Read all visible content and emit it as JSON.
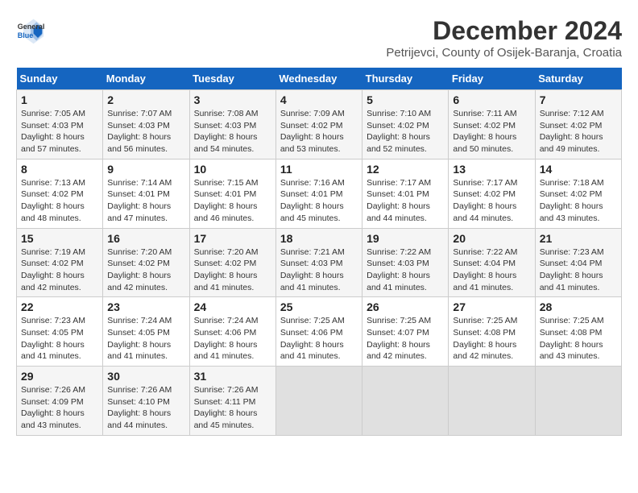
{
  "header": {
    "logo_line1": "General",
    "logo_line2": "Blue",
    "title": "December 2024",
    "subtitle": "Petrijevci, County of Osijek-Baranja, Croatia"
  },
  "days_of_week": [
    "Sunday",
    "Monday",
    "Tuesday",
    "Wednesday",
    "Thursday",
    "Friday",
    "Saturday"
  ],
  "weeks": [
    [
      {
        "day": "1",
        "info": "Sunrise: 7:05 AM\nSunset: 4:03 PM\nDaylight: 8 hours and 57 minutes."
      },
      {
        "day": "2",
        "info": "Sunrise: 7:07 AM\nSunset: 4:03 PM\nDaylight: 8 hours and 56 minutes."
      },
      {
        "day": "3",
        "info": "Sunrise: 7:08 AM\nSunset: 4:03 PM\nDaylight: 8 hours and 54 minutes."
      },
      {
        "day": "4",
        "info": "Sunrise: 7:09 AM\nSunset: 4:02 PM\nDaylight: 8 hours and 53 minutes."
      },
      {
        "day": "5",
        "info": "Sunrise: 7:10 AM\nSunset: 4:02 PM\nDaylight: 8 hours and 52 minutes."
      },
      {
        "day": "6",
        "info": "Sunrise: 7:11 AM\nSunset: 4:02 PM\nDaylight: 8 hours and 50 minutes."
      },
      {
        "day": "7",
        "info": "Sunrise: 7:12 AM\nSunset: 4:02 PM\nDaylight: 8 hours and 49 minutes."
      }
    ],
    [
      {
        "day": "8",
        "info": "Sunrise: 7:13 AM\nSunset: 4:02 PM\nDaylight: 8 hours and 48 minutes."
      },
      {
        "day": "9",
        "info": "Sunrise: 7:14 AM\nSunset: 4:01 PM\nDaylight: 8 hours and 47 minutes."
      },
      {
        "day": "10",
        "info": "Sunrise: 7:15 AM\nSunset: 4:01 PM\nDaylight: 8 hours and 46 minutes."
      },
      {
        "day": "11",
        "info": "Sunrise: 7:16 AM\nSunset: 4:01 PM\nDaylight: 8 hours and 45 minutes."
      },
      {
        "day": "12",
        "info": "Sunrise: 7:17 AM\nSunset: 4:01 PM\nDaylight: 8 hours and 44 minutes."
      },
      {
        "day": "13",
        "info": "Sunrise: 7:17 AM\nSunset: 4:02 PM\nDaylight: 8 hours and 44 minutes."
      },
      {
        "day": "14",
        "info": "Sunrise: 7:18 AM\nSunset: 4:02 PM\nDaylight: 8 hours and 43 minutes."
      }
    ],
    [
      {
        "day": "15",
        "info": "Sunrise: 7:19 AM\nSunset: 4:02 PM\nDaylight: 8 hours and 42 minutes."
      },
      {
        "day": "16",
        "info": "Sunrise: 7:20 AM\nSunset: 4:02 PM\nDaylight: 8 hours and 42 minutes."
      },
      {
        "day": "17",
        "info": "Sunrise: 7:20 AM\nSunset: 4:02 PM\nDaylight: 8 hours and 41 minutes."
      },
      {
        "day": "18",
        "info": "Sunrise: 7:21 AM\nSunset: 4:03 PM\nDaylight: 8 hours and 41 minutes."
      },
      {
        "day": "19",
        "info": "Sunrise: 7:22 AM\nSunset: 4:03 PM\nDaylight: 8 hours and 41 minutes."
      },
      {
        "day": "20",
        "info": "Sunrise: 7:22 AM\nSunset: 4:04 PM\nDaylight: 8 hours and 41 minutes."
      },
      {
        "day": "21",
        "info": "Sunrise: 7:23 AM\nSunset: 4:04 PM\nDaylight: 8 hours and 41 minutes."
      }
    ],
    [
      {
        "day": "22",
        "info": "Sunrise: 7:23 AM\nSunset: 4:05 PM\nDaylight: 8 hours and 41 minutes."
      },
      {
        "day": "23",
        "info": "Sunrise: 7:24 AM\nSunset: 4:05 PM\nDaylight: 8 hours and 41 minutes."
      },
      {
        "day": "24",
        "info": "Sunrise: 7:24 AM\nSunset: 4:06 PM\nDaylight: 8 hours and 41 minutes."
      },
      {
        "day": "25",
        "info": "Sunrise: 7:25 AM\nSunset: 4:06 PM\nDaylight: 8 hours and 41 minutes."
      },
      {
        "day": "26",
        "info": "Sunrise: 7:25 AM\nSunset: 4:07 PM\nDaylight: 8 hours and 42 minutes."
      },
      {
        "day": "27",
        "info": "Sunrise: 7:25 AM\nSunset: 4:08 PM\nDaylight: 8 hours and 42 minutes."
      },
      {
        "day": "28",
        "info": "Sunrise: 7:25 AM\nSunset: 4:08 PM\nDaylight: 8 hours and 43 minutes."
      }
    ],
    [
      {
        "day": "29",
        "info": "Sunrise: 7:26 AM\nSunset: 4:09 PM\nDaylight: 8 hours and 43 minutes."
      },
      {
        "day": "30",
        "info": "Sunrise: 7:26 AM\nSunset: 4:10 PM\nDaylight: 8 hours and 44 minutes."
      },
      {
        "day": "31",
        "info": "Sunrise: 7:26 AM\nSunset: 4:11 PM\nDaylight: 8 hours and 45 minutes."
      },
      {
        "day": "",
        "info": ""
      },
      {
        "day": "",
        "info": ""
      },
      {
        "day": "",
        "info": ""
      },
      {
        "day": "",
        "info": ""
      }
    ]
  ]
}
